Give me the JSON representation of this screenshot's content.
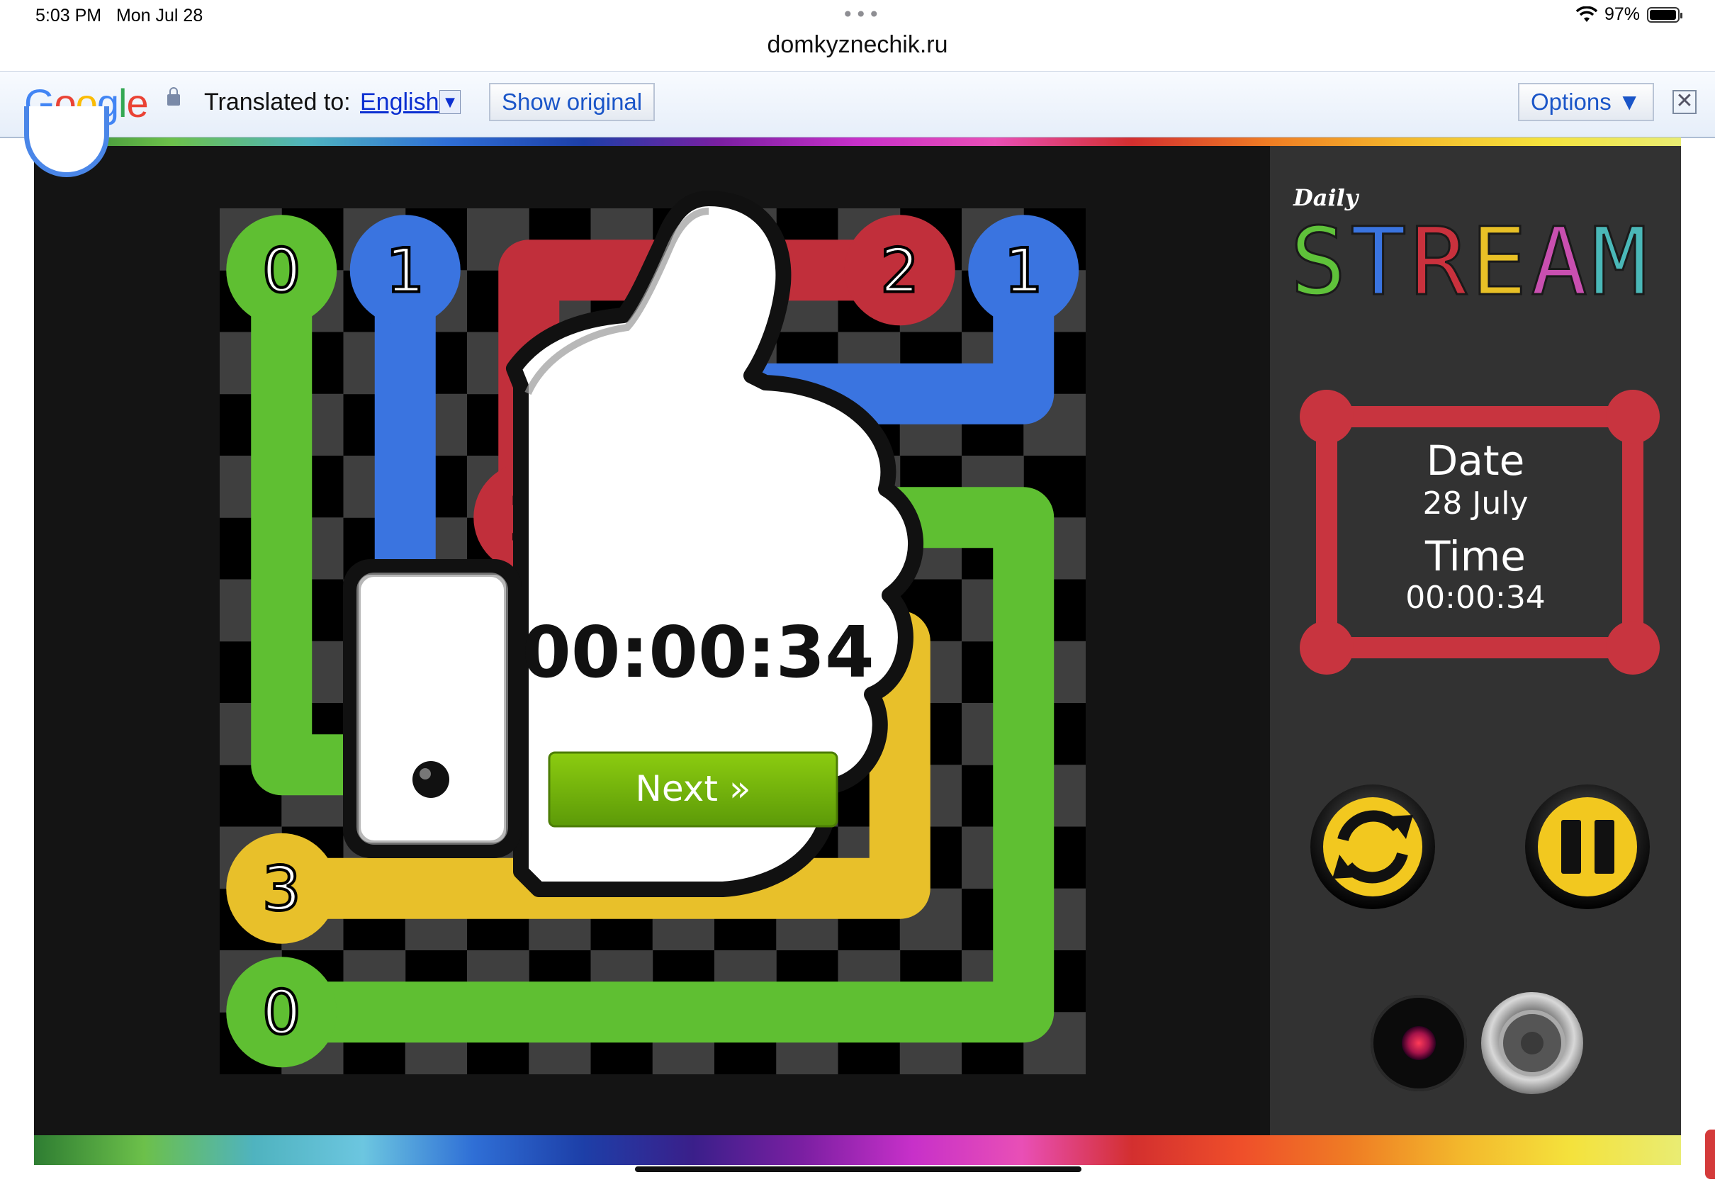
{
  "status_bar": {
    "time": "5:03 PM",
    "date": "Mon Jul 28",
    "battery": "97%",
    "battery_level": 0.97,
    "more": "•••"
  },
  "browser": {
    "url": "domkyznechik.ru"
  },
  "translate_bar": {
    "logo": "Google",
    "translated_to": "Translated to:",
    "language": "English",
    "dropdown_arrow": "▼",
    "show_original": "Show original",
    "options": "Options ▼",
    "close": "✕",
    "lock_icon": "lock-icon"
  },
  "game": {
    "title_small": "Daily",
    "title": "STREAM",
    "title_colors": [
      "#5fc23a",
      "#3a74e0",
      "#c9313d",
      "#e8c026",
      "#c94fb0",
      "#4ab8b8"
    ],
    "date_label": "Date",
    "date_value": "28 July",
    "time_label": "Time",
    "time_value": "00:00:34",
    "popup_time": "00:00:34",
    "next_button": "Next »",
    "restart_icon": "restart-icon",
    "pause_icon": "pause-icon",
    "record_icon": "record-icon",
    "speaker_icon": "speaker-icon",
    "colors": {
      "green": "#5fbf32",
      "blue": "#3a74e0",
      "red": "#c12f3b",
      "yellow": "#e8c02a",
      "frame_red": "#c8343f",
      "button_yellow": "#f2c81f"
    },
    "grid": {
      "rows": 7,
      "cols": 7,
      "endpoints": [
        {
          "row": 0,
          "col": 0,
          "label": "0",
          "color": "green"
        },
        {
          "row": 6,
          "col": 0,
          "label": "0",
          "color": "green"
        },
        {
          "row": 0,
          "col": 1,
          "label": "1",
          "color": "blue"
        },
        {
          "row": 0,
          "col": 6,
          "label": "1",
          "color": "blue"
        },
        {
          "row": 0,
          "col": 5,
          "label": "2",
          "color": "red"
        },
        {
          "row": 2,
          "col": 2,
          "label": "2",
          "color": "red"
        },
        {
          "row": 5,
          "col": 0,
          "label": "3",
          "color": "yellow"
        }
      ],
      "paths": [
        {
          "color": "green",
          "cells": [
            [
              0,
              0
            ],
            [
              1,
              0
            ],
            [
              2,
              0
            ],
            [
              3,
              0
            ],
            [
              4,
              0
            ],
            [
              4,
              1
            ]
          ]
        },
        {
          "color": "green",
          "cells": [
            [
              6,
              0
            ],
            [
              6,
              1
            ],
            [
              6,
              2
            ],
            [
              6,
              3
            ],
            [
              6,
              4
            ],
            [
              6,
              5
            ],
            [
              6,
              6
            ],
            [
              5,
              6
            ],
            [
              4,
              6
            ],
            [
              3,
              6
            ],
            [
              2,
              6
            ],
            [
              2,
              5
            ]
          ]
        },
        {
          "color": "blue",
          "cells": [
            [
              0,
              1
            ],
            [
              1,
              1
            ],
            [
              2,
              1
            ],
            [
              3,
              1
            ]
          ]
        },
        {
          "color": "blue",
          "cells": [
            [
              0,
              6
            ],
            [
              1,
              6
            ],
            [
              1,
              5
            ],
            [
              1,
              4
            ],
            [
              1,
              3
            ]
          ]
        },
        {
          "color": "red",
          "cells": [
            [
              0,
              5
            ],
            [
              0,
              4
            ],
            [
              0,
              3
            ],
            [
              0,
              2
            ],
            [
              1,
              2
            ],
            [
              2,
              2
            ]
          ]
        },
        {
          "color": "yellow",
          "cells": [
            [
              5,
              0
            ],
            [
              5,
              1
            ],
            [
              5,
              2
            ],
            [
              5,
              3
            ],
            [
              5,
              4
            ],
            [
              5,
              5
            ],
            [
              4,
              5
            ],
            [
              3,
              5
            ]
          ]
        }
      ]
    }
  }
}
